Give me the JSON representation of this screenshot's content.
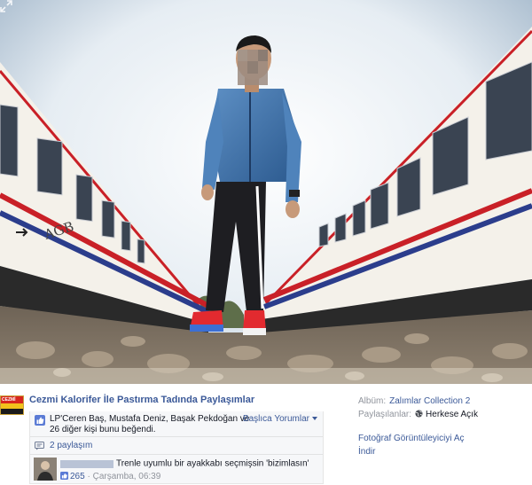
{
  "photo": {
    "expand_icon": "expand-arrows-icon"
  },
  "page": {
    "name": "Cezmi Kalorifer İle Pastırma Tadında Paylaşımlar",
    "logo_icon": "page-logo",
    "logo_text": "CEZMİ"
  },
  "feedback": {
    "likers_text": "LP'Ceren Baş, Mustafa Deniz, Başak Pekdoğan ve 26 diğer kişi bunu beğendi.",
    "top_comments_label": "Başlıca Yorumlar",
    "shares_label": "2 paylaşım"
  },
  "comment": {
    "text": "Trenle uyumlu bir ayakkabı seçmişsin 'bizimlasın'",
    "like_count": "265",
    "separator": "·",
    "time": "Çarşamba, 06:39"
  },
  "side": {
    "album_label": "Albüm:",
    "album_value": "Zalımlar Collection 2",
    "shared_with_label": "Paylaşılanlar:",
    "shared_with_value": "Herkese Açık",
    "viewer_link": "Fotoğraf Görüntüleyiciyi Aç",
    "download_link": "İndir"
  },
  "colors": {
    "link": "#3b5998",
    "muted": "#90949c",
    "panel_bg": "#f6f7f9"
  }
}
